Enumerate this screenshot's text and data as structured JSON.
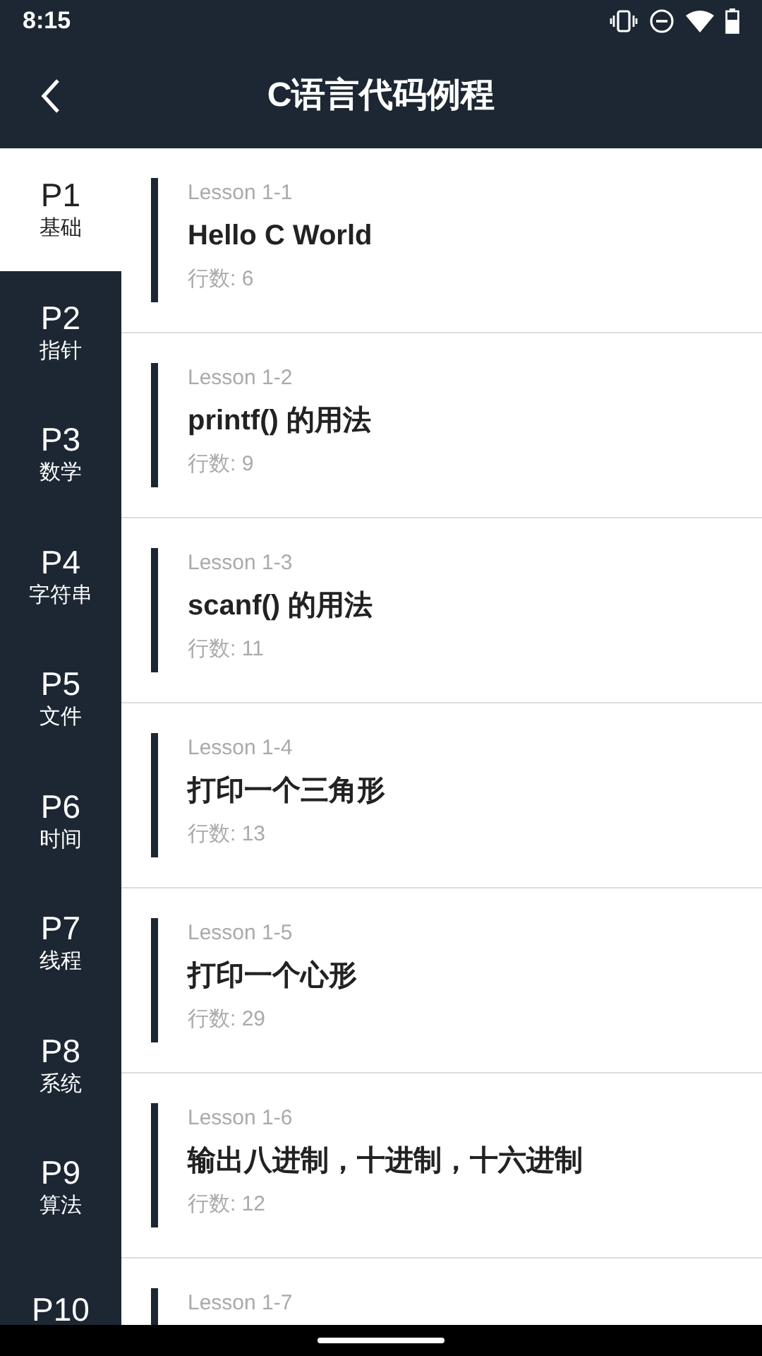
{
  "status_bar": {
    "time": "8:15"
  },
  "app_bar": {
    "title": "C语言代码例程"
  },
  "sidebar": {
    "items": [
      {
        "label": "P1",
        "sublabel": "基础",
        "selected": true
      },
      {
        "label": "P2",
        "sublabel": "指针",
        "selected": false
      },
      {
        "label": "P3",
        "sublabel": "数学",
        "selected": false
      },
      {
        "label": "P4",
        "sublabel": "字符串",
        "selected": false
      },
      {
        "label": "P5",
        "sublabel": "文件",
        "selected": false
      },
      {
        "label": "P6",
        "sublabel": "时间",
        "selected": false
      },
      {
        "label": "P7",
        "sublabel": "线程",
        "selected": false
      },
      {
        "label": "P8",
        "sublabel": "系统",
        "selected": false
      },
      {
        "label": "P9",
        "sublabel": "算法",
        "selected": false
      },
      {
        "label": "P10",
        "selected": false
      }
    ]
  },
  "lessons": [
    {
      "lesson": "Lesson 1-1",
      "title": "Hello C World",
      "lines": "行数: 6"
    },
    {
      "lesson": "Lesson 1-2",
      "title": "printf() 的用法",
      "lines": "行数: 9"
    },
    {
      "lesson": "Lesson 1-3",
      "title": "scanf() 的用法",
      "lines": "行数: 11"
    },
    {
      "lesson": "Lesson 1-4",
      "title": "打印一个三角形",
      "lines": "行数: 13"
    },
    {
      "lesson": "Lesson 1-5",
      "title": "打印一个心形",
      "lines": "行数: 29"
    },
    {
      "lesson": "Lesson 1-6",
      "title": "输出八进制，十进制，十六进制",
      "lines": "行数: 12"
    },
    {
      "lesson": "Lesson 1-7"
    }
  ]
}
